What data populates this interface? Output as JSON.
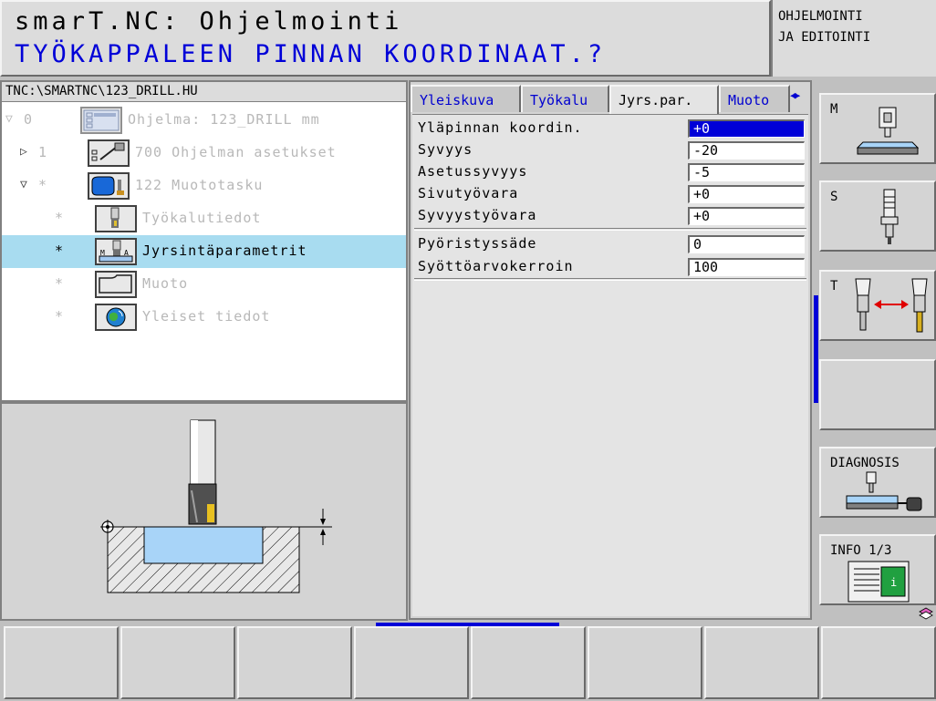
{
  "header": {
    "app_title": "smarT.NC: Ohjelmointi",
    "prompt": "TYÖKAPPALEEN PINNAN KOORDINAAT.?",
    "mode_line1": "OHJELMOINTI",
    "mode_line2": "JA EDITOINTI"
  },
  "tree": {
    "path": "TNC:\\SMARTNC\\123_DRILL.HU",
    "items": [
      {
        "marker": "▽",
        "num": "0",
        "label": "Ohjelma: 123_DRILL mm",
        "icon": "program-icon"
      },
      {
        "marker": "▷",
        "num": "1",
        "label": "700 Ohjelman asetukset",
        "icon": "settings-icon"
      },
      {
        "marker": "▽",
        "num": "*",
        "label": "122 Muototasku",
        "icon": "contour-pocket-icon"
      },
      {
        "marker": "",
        "num": "*",
        "label": "Työkalutiedot",
        "icon": "tool-data-icon"
      },
      {
        "marker": "",
        "num": "*",
        "label": "Jyrsintäparametrit",
        "icon": "milling-params-icon"
      },
      {
        "marker": "",
        "num": "*",
        "label": "Muoto",
        "icon": "contour-icon"
      },
      {
        "marker": "",
        "num": "*",
        "label": "Yleiset tiedot",
        "icon": "global-data-icon"
      }
    ]
  },
  "tabs": {
    "items": [
      "Yleiskuva",
      "Työkalu",
      "Jyrs.par.",
      "Muoto"
    ],
    "active": "Jyrs.par.",
    "arrows": "◀▶"
  },
  "form": {
    "group1": [
      {
        "label": "Yläpinnan koordin.",
        "value": "+0"
      },
      {
        "label": "Syvyys",
        "value": "-20"
      },
      {
        "label": "Asetussyvyys",
        "value": "-5"
      },
      {
        "label": "Sivutyövara",
        "value": "+0"
      },
      {
        "label": "Syvyystyövara",
        "value": "+0"
      }
    ],
    "group2": [
      {
        "label": "Pyöristyssäde",
        "value": "0"
      },
      {
        "label": "Syöttöarvokerroin",
        "value": "100"
      }
    ]
  },
  "side_softkeys": [
    {
      "label": "M",
      "icon": "machine-icon"
    },
    {
      "label": "S",
      "icon": "spindle-icon"
    },
    {
      "label": "T",
      "icon": "tool-change-icon"
    },
    {
      "label": "",
      "icon": ""
    },
    {
      "label": "DIAGNOSIS",
      "icon": "diagnosis-icon"
    },
    {
      "label": "INFO 1/3",
      "icon": "info-icon"
    }
  ],
  "colors": {
    "accent_blue": "#0000d8",
    "selection": "#a8dcf0",
    "pocket_fill": "#a8d4f8"
  }
}
